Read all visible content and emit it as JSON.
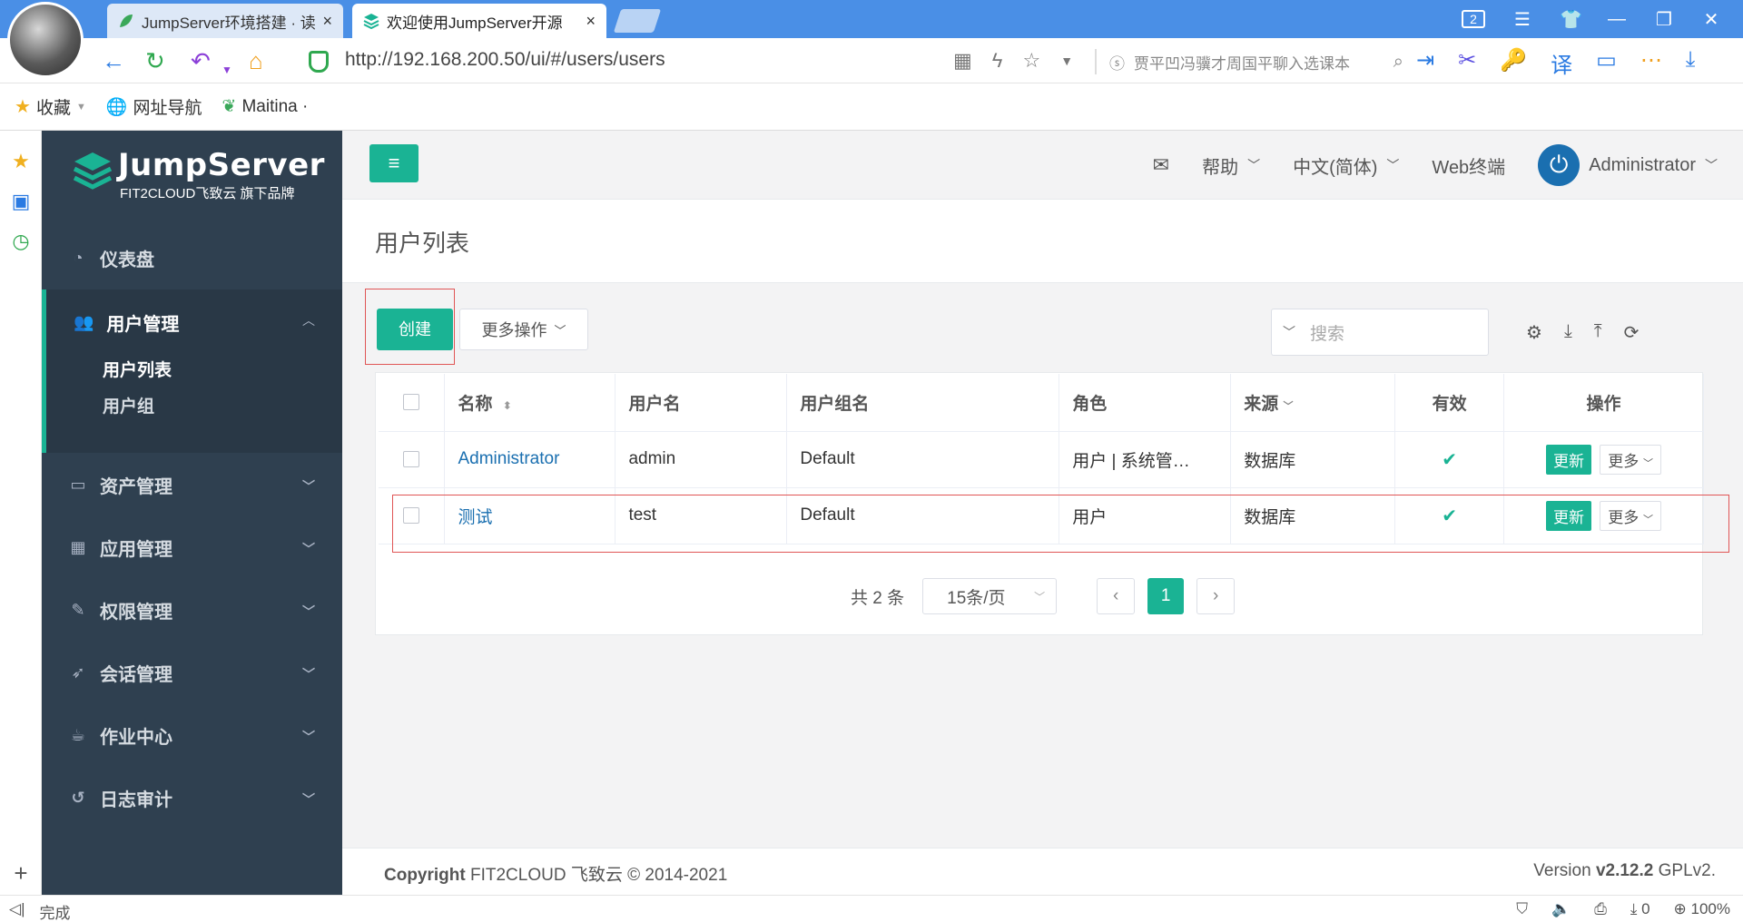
{
  "browser": {
    "tabs": [
      {
        "title": "JumpServer环境搭建 · 读",
        "close": "×"
      },
      {
        "title": "欢迎使用JumpServer开源",
        "close": "×"
      }
    ],
    "window_badge": "2",
    "url": "http://192.168.200.50/ui/#/users/users",
    "search_placeholder": "贾平凹冯骥才周国平聊入选课本",
    "bookmarks": [
      {
        "label": "收藏",
        "icon": "star-icon"
      },
      {
        "label": "网址导航",
        "icon": "globe-icon"
      },
      {
        "label": "Maitina ·",
        "icon": "leaf-icon"
      }
    ],
    "status_left": "完成",
    "status_right": {
      "download_count": "0",
      "zoom": "100%"
    }
  },
  "app": {
    "logo": {
      "name": "JumpServer",
      "sub": "FIT2CLOUD飞致云 旗下品牌"
    },
    "menu": [
      {
        "label": "仪表盘",
        "icon": "dashboard-icon"
      },
      {
        "label": "用户管理",
        "icon": "users-icon"
      },
      {
        "label": "资产管理",
        "icon": "inbox-icon"
      },
      {
        "label": "应用管理",
        "icon": "apps-icon"
      },
      {
        "label": "权限管理",
        "icon": "edit-icon"
      },
      {
        "label": "会话管理",
        "icon": "rocket-icon"
      },
      {
        "label": "作业中心",
        "icon": "coffee-icon"
      },
      {
        "label": "日志审计",
        "icon": "history-icon"
      }
    ],
    "submenu": [
      {
        "label": "用户列表"
      },
      {
        "label": "用户组"
      }
    ],
    "topnav": {
      "help": "帮助",
      "language": "中文(简体)",
      "web_terminal": "Web终端",
      "user": "Administrator"
    },
    "page_title": "用户列表",
    "toolbar": {
      "create": "创建",
      "more_actions": "更多操作",
      "search_placeholder": "搜索"
    },
    "table": {
      "headers": [
        "名称",
        "用户名",
        "用户组名",
        "角色",
        "来源",
        "有效",
        "操作"
      ],
      "rows": [
        {
          "name": "Administrator",
          "username": "admin",
          "group": "Default",
          "role": "用户 | 系统管…",
          "source": "数据库",
          "valid": "✔",
          "update": "更新",
          "more": "更多"
        },
        {
          "name": "测试",
          "username": "test",
          "group": "Default",
          "role": "用户",
          "source": "数据库",
          "valid": "✔",
          "update": "更新",
          "more": "更多"
        }
      ]
    },
    "pagination": {
      "total": "共 2 条",
      "page_size": "15条/页",
      "current": "1"
    },
    "footer": {
      "copyright_bold": "Copyright",
      "copyright_rest": " FIT2CLOUD 飞致云 © 2014-2021",
      "version_prefix": "Version ",
      "version": "v2.12.2",
      "version_suffix": " GPLv2."
    }
  },
  "colors": {
    "accent": "#1ab394",
    "sidebar": "#2f4050",
    "browser_blue": "#4a8fe6",
    "link": "#1a6fb0",
    "highlight": "#e05555"
  }
}
